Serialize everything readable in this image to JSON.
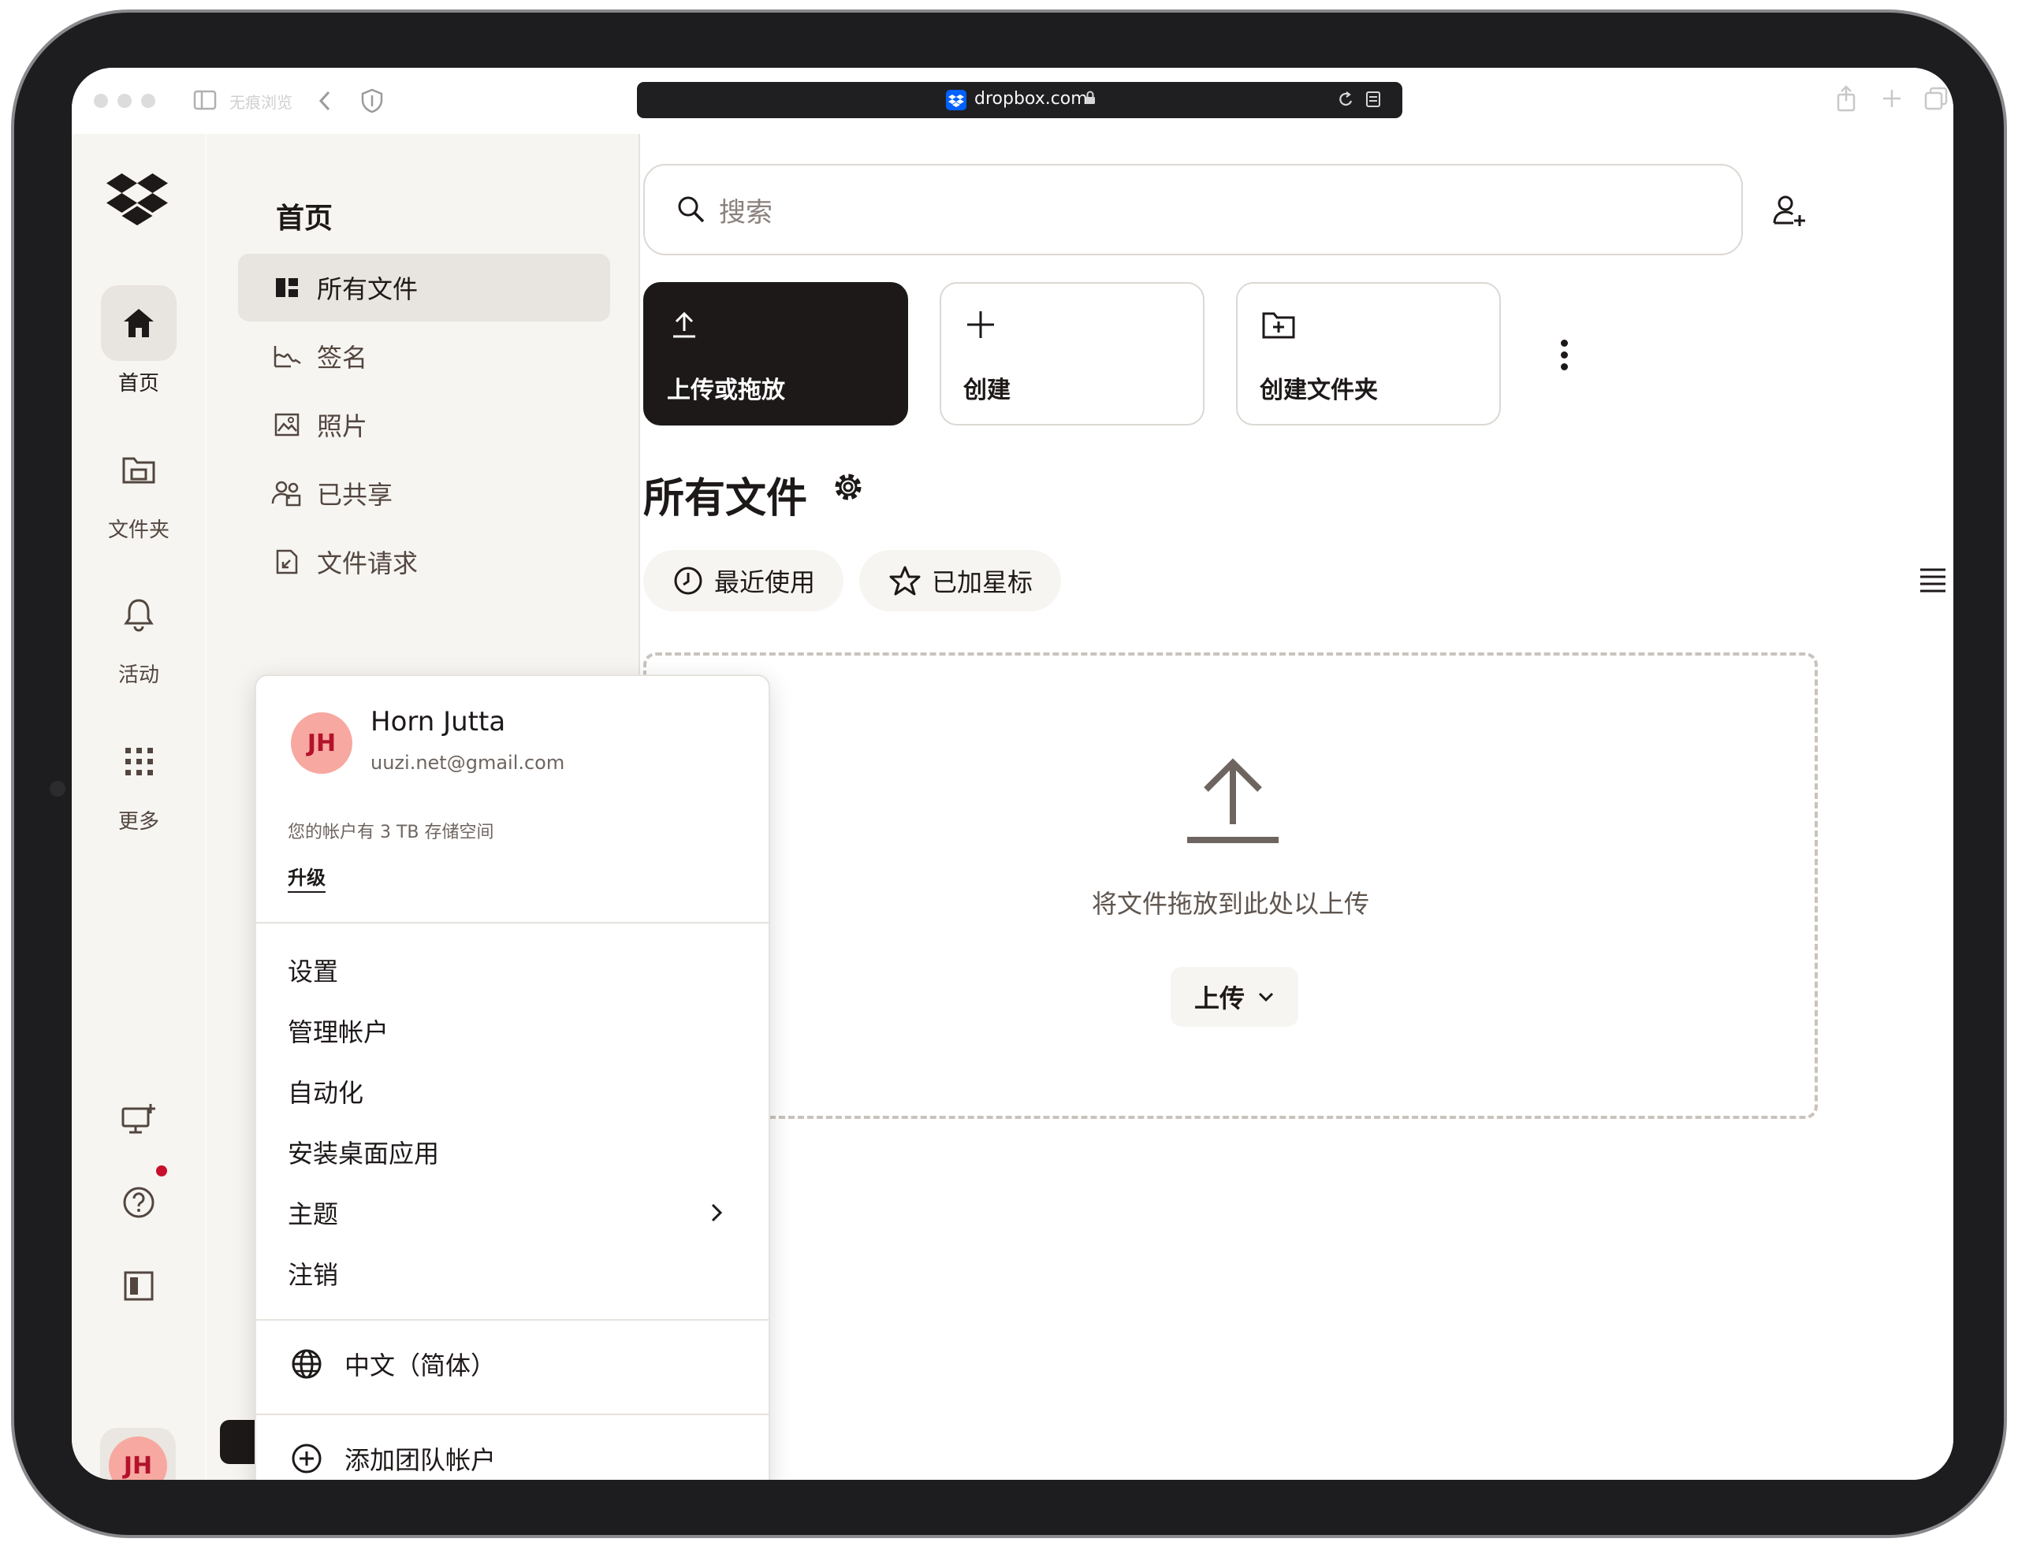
{
  "browser": {
    "tab_label": "无痕浏览",
    "url": "dropbox.com"
  },
  "rail": {
    "items": [
      {
        "label": "首页",
        "icon": "home-icon",
        "active": true
      },
      {
        "label": "文件夹",
        "icon": "folder-icon",
        "active": false
      },
      {
        "label": "活动",
        "icon": "bell-icon",
        "active": false
      },
      {
        "label": "更多",
        "icon": "grid-icon",
        "active": false
      }
    ],
    "avatar_initials": "JH"
  },
  "subnav": {
    "title": "首页",
    "items": [
      {
        "label": "所有文件",
        "icon": "all-files-icon",
        "active": true
      },
      {
        "label": "签名",
        "icon": "signature-icon",
        "active": false
      },
      {
        "label": "照片",
        "icon": "photo-icon",
        "active": false
      },
      {
        "label": "已共享",
        "icon": "shared-icon",
        "active": false
      },
      {
        "label": "文件请求",
        "icon": "file-request-icon",
        "active": false
      }
    ]
  },
  "search": {
    "placeholder": "搜索"
  },
  "actions": [
    {
      "label": "上传或拖放",
      "icon": "upload-icon"
    },
    {
      "label": "创建",
      "icon": "plus-icon"
    },
    {
      "label": "创建文件夹",
      "icon": "new-folder-icon"
    }
  ],
  "section": {
    "title": "所有文件"
  },
  "filters": [
    {
      "label": "最近使用",
      "icon": "clock-icon"
    },
    {
      "label": "已加星标",
      "icon": "star-icon"
    }
  ],
  "dropzone": {
    "text": "将文件拖放到此处以上传",
    "button_label": "上传"
  },
  "account_menu": {
    "avatar_initials": "JH",
    "name": "Horn Jutta",
    "email": "uuzi.net@gmail.com",
    "storage_text": "您的帐户有 3 TB 存储空间",
    "upgrade_label": "升级",
    "items": [
      "设置",
      "管理帐户",
      "自动化",
      "安装桌面应用",
      "主题",
      "注销"
    ],
    "language_label": "中文（简体）",
    "add_team_label": "添加团队帐户"
  },
  "colors": {
    "brand": "#0061fe",
    "primary_button": "#1e1919",
    "avatar_bg": "#f7a8a0",
    "avatar_text": "#b3122d",
    "notification_dot": "#c8102e",
    "sidebar_bg": "#f7f5f2"
  }
}
